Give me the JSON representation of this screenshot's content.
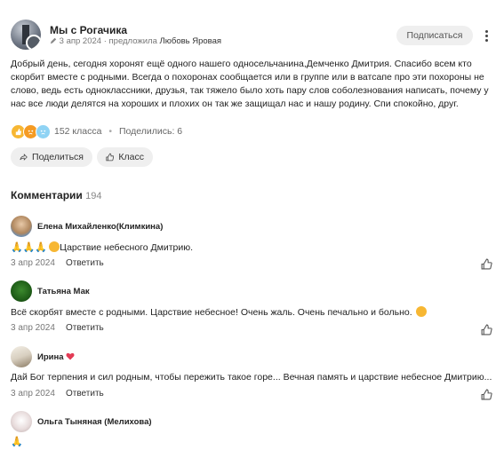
{
  "post": {
    "group_name": "Мы с Рогачика",
    "date": "3 апр 2024",
    "suggested_by": "предложила",
    "author": "Любовь Яровая",
    "subscribe_label": "Подписаться",
    "text": "Добрый день, сегодня хоронят ещё одного нашего односельчанина,Демченко Дмитрия. Спасибо всем кто скорбит вместе с родными. Всегда о похоронах сообщается или в группе или в ватсапе про эти похороны не слово, ведь есть одноклассники, друзья, так тяжело было хоть пару слов соболезнования написать, почему у нас все люди делятся на хороших и плохих он так же защищал нас и нашу родину. Спи спокойно, друг.",
    "reactions_count": "152 класса",
    "shares": "Поделились: 6",
    "share_label": "Поделиться",
    "like_label": "Класс"
  },
  "comments_header": {
    "title": "Комментарии",
    "count": "194"
  },
  "comments": [
    {
      "name": "Елена Михайленко(Климкина)",
      "emoji_prefix": "🙏🙏🙏",
      "text": "Царствие небесного Дмитрию.",
      "date": "3 апр 2024",
      "reply": "Ответить"
    },
    {
      "name": "Татьяна Мак",
      "text": "Всё скорбят вместе с родными. Царствие небесное! Очень жаль. Очень печально и больно.",
      "date": "3 апр 2024",
      "reply": "Ответить"
    },
    {
      "name": "Ирина",
      "text": "Дай Бог терпения и сил родным, чтобы пережить такое горе... Вечная память и царствие небесное Дмитрию...",
      "date": "3 апр 2024",
      "reply": "Ответить"
    },
    {
      "name": "Ольга Тыняная (Мелихова)",
      "emoji_prefix": "🙏"
    }
  ],
  "icons": {
    "more": "more-vertical-icon",
    "share": "share-arrow-icon",
    "like": "thumbs-up-icon",
    "edit": "pencil-icon"
  },
  "colors": {
    "pill_bg": "#efefef",
    "text": "#222222",
    "muted": "#777777"
  }
}
